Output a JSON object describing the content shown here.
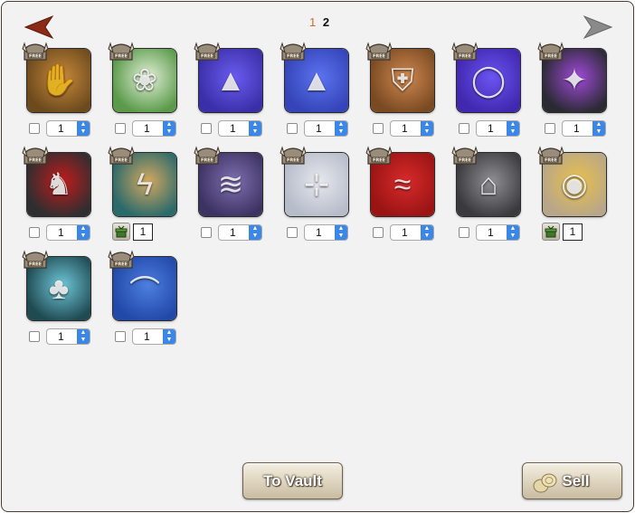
{
  "pagination": {
    "pages": [
      {
        "label": "1",
        "current": false
      },
      {
        "label": "2",
        "current": true
      }
    ],
    "prev_color": "#8b2a16",
    "next_color": "#8a8a8a"
  },
  "items": [
    {
      "name": "brown-claw-gauntlet",
      "bg": "#6d4a1e",
      "accent": "#c98a3a",
      "glyph": "✋",
      "qty": "1",
      "kind": "normal"
    },
    {
      "name": "leafy-flower-garland",
      "bg": "#5a9a4a",
      "accent": "#e3f0d8",
      "glyph": "❀",
      "qty": "1",
      "kind": "normal"
    },
    {
      "name": "purple-triangle-scarf",
      "bg": "#3a2fa8",
      "accent": "#6a5cf0",
      "glyph": "▲",
      "qty": "1",
      "kind": "normal"
    },
    {
      "name": "blue-triangle-scarf",
      "bg": "#3544b8",
      "accent": "#5c73f0",
      "glyph": "▲",
      "qty": "1",
      "kind": "normal"
    },
    {
      "name": "bronze-armor-plate",
      "bg": "#7a4a22",
      "accent": "#d08850",
      "glyph": "⛨",
      "qty": "1",
      "kind": "normal"
    },
    {
      "name": "sapphire-ring",
      "bg": "#4028b0",
      "accent": "#6b53f0",
      "glyph": "◯",
      "qty": "1",
      "kind": "normal"
    },
    {
      "name": "shadow-talons",
      "bg": "#2a2a33",
      "accent": "#a04ad8",
      "glyph": "✦",
      "qty": "1",
      "kind": "normal"
    },
    {
      "name": "crimson-horned-mask",
      "bg": "#2e2e30",
      "accent": "#c21b1b",
      "glyph": "♞",
      "qty": "1",
      "kind": "normal"
    },
    {
      "name": "lightning-gauntlets",
      "bg": "#2a6a6a",
      "accent": "#d4a860",
      "glyph": "ϟ",
      "qty": "1",
      "kind": "gift"
    },
    {
      "name": "violet-folded-cloth",
      "bg": "#3d3363",
      "accent": "#7f6fb0",
      "glyph": "≋",
      "qty": "1",
      "kind": "normal"
    },
    {
      "name": "white-shirt",
      "bg": "#b7bcc9",
      "accent": "#e6e8ef",
      "glyph": "⊹",
      "qty": "1",
      "kind": "normal"
    },
    {
      "name": "red-scarf",
      "bg": "#9a1414",
      "accent": "#d82a2a",
      "glyph": "≈",
      "qty": "1",
      "kind": "normal"
    },
    {
      "name": "dark-cloak",
      "bg": "#3a3a3e",
      "accent": "#8f8f95",
      "glyph": "⌂",
      "qty": "1",
      "kind": "normal"
    },
    {
      "name": "steampunk-goggles",
      "bg": "#b8a68a",
      "accent": "#e8c04a",
      "glyph": "◉",
      "qty": "1",
      "kind": "gift"
    },
    {
      "name": "mushroom-glade",
      "bg": "#1f4a52",
      "accent": "#6fc7d8",
      "glyph": "♣",
      "qty": "1",
      "kind": "normal"
    },
    {
      "name": "blue-wizard-hat",
      "bg": "#2149a8",
      "accent": "#4d7ee0",
      "glyph": "⌒",
      "qty": "1",
      "kind": "normal"
    }
  ],
  "spinner_glyph": "⌃⌄",
  "buttons": {
    "to_vault": "To Vault",
    "sell": "Sell"
  },
  "colors": {
    "panel_bg": "#f3f2f2",
    "panel_border": "#4a3a33",
    "spinner_blue": "#3b87e8",
    "page_other": "#d06a2c"
  }
}
